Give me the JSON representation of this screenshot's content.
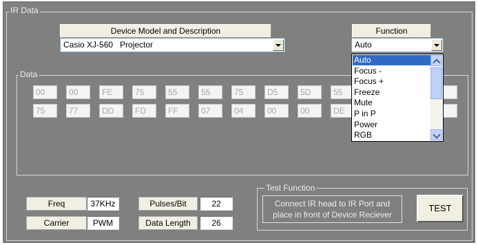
{
  "ir_group": {
    "title": "IR Data"
  },
  "device": {
    "header": "Device Model and Description",
    "selected": "Casio XJ-560   Projector"
  },
  "function": {
    "header": "Function",
    "selected": "Auto",
    "options": [
      "Auto",
      "Focus -",
      "Focus +",
      "Freeze",
      "Mute",
      "P in P",
      "Power",
      "RGB"
    ],
    "highlighted": "Auto"
  },
  "data_group": {
    "title": "Data",
    "row1": [
      "00",
      "00",
      "FE",
      "75",
      "55",
      "55",
      "75",
      "D5",
      "5D",
      "55"
    ],
    "row2": [
      "75",
      "77",
      "DD",
      "FD",
      "FF",
      "07",
      "04",
      "00",
      "00",
      "DE"
    ]
  },
  "params": {
    "freq_label": "Freq",
    "freq_value": "37KHz",
    "carrier_label": "Carrier",
    "carrier_value": "PWM",
    "pulses_label": "Pulses/Bit",
    "pulses_value": "22",
    "length_label": "Data Length",
    "length_value": "26"
  },
  "test_function": {
    "title": "Test Function",
    "instruction_line1": "Connect IR head to IR Port and",
    "instruction_line2": "place in front of Device Reciever",
    "button_label": "TEST"
  }
}
